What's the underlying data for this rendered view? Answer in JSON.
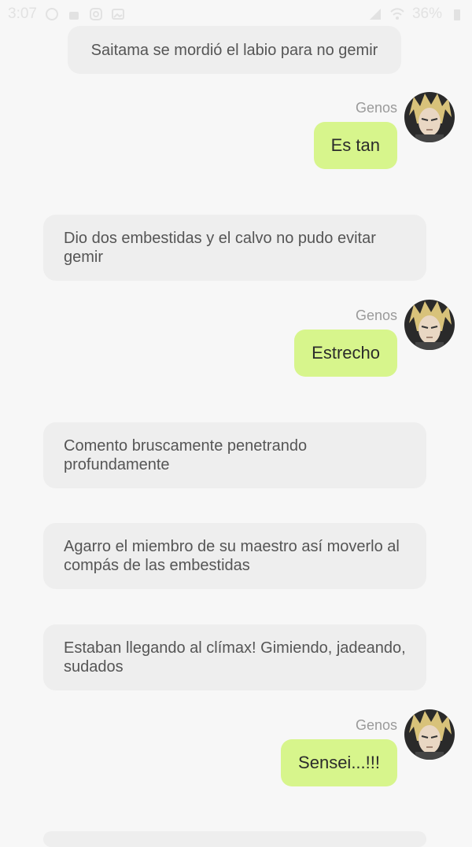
{
  "status_bar": {
    "time": "3:07",
    "battery": "36%"
  },
  "messages": [
    {
      "type": "narration",
      "text": "Saitama se mordió el labio para no gemir"
    },
    {
      "type": "character",
      "name": "Genos",
      "text": "Es tan"
    },
    {
      "type": "narration",
      "text": "Dio dos embestidas y el calvo no pudo evitar gemir"
    },
    {
      "type": "character",
      "name": "Genos",
      "text": "Estrecho"
    },
    {
      "type": "narration",
      "text": "Comento bruscamente penetrando profundamente"
    },
    {
      "type": "narration",
      "text": "Agarro el miembro de su maestro así moverlo al compás de las embestidas"
    },
    {
      "type": "narration",
      "text": "Estaban llegando al clímax! Gimiendo, jadeando, sudados"
    },
    {
      "type": "character",
      "name": "Genos",
      "text": "Sensei...!!!"
    }
  ],
  "colors": {
    "background": "#f7f7f7",
    "narration_bg": "#eeeeee",
    "character_bubble_bg": "#d7f58c",
    "name_text": "#9a9a9a"
  },
  "icons": [
    "avatar-genos"
  ]
}
